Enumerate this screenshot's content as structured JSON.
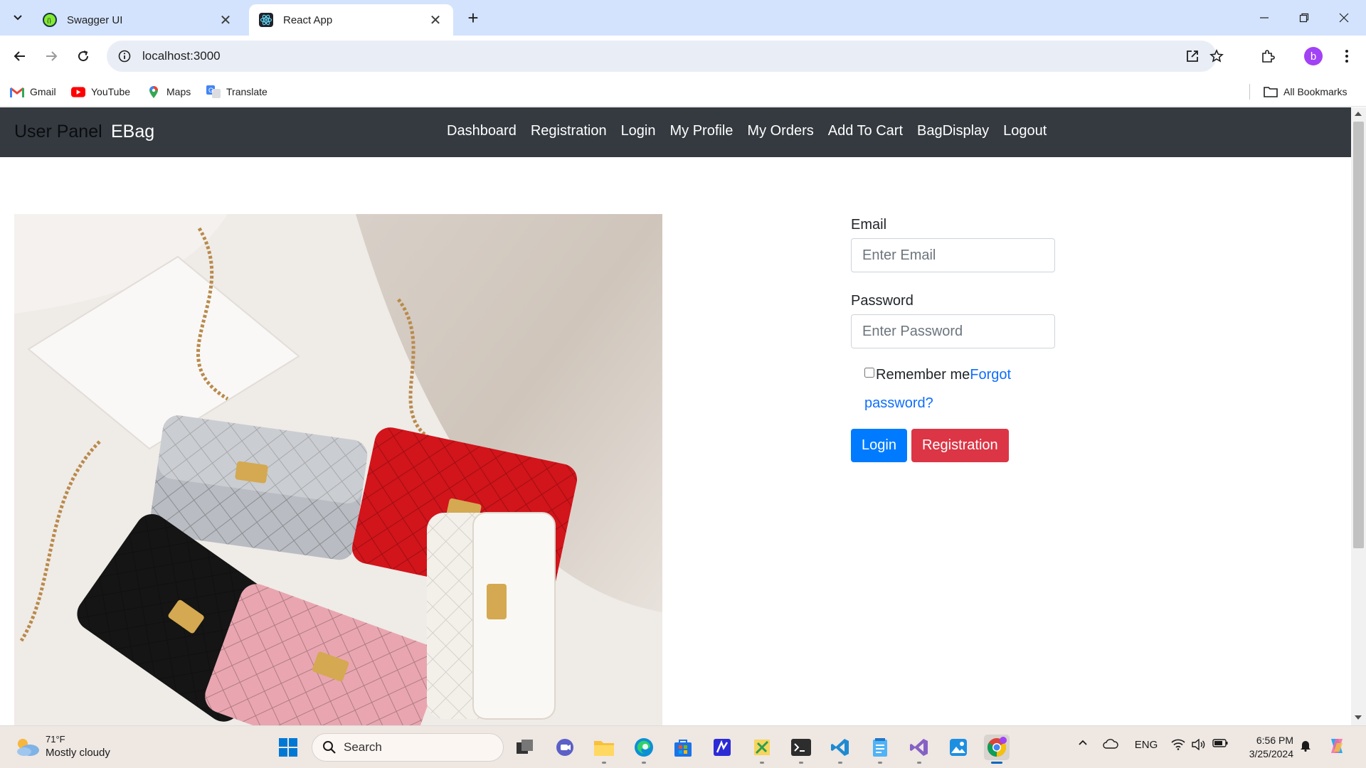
{
  "browser": {
    "tabs": [
      {
        "title": "Swagger UI",
        "active": false,
        "favicon": "swagger-icon"
      },
      {
        "title": "React App",
        "active": true,
        "favicon": "react-icon"
      }
    ],
    "url": "localhost:3000",
    "bookmarks": [
      {
        "label": "Gmail",
        "icon": "gmail-icon"
      },
      {
        "label": "YouTube",
        "icon": "youtube-icon"
      },
      {
        "label": "Maps",
        "icon": "maps-icon"
      },
      {
        "label": "Translate",
        "icon": "translate-icon"
      }
    ],
    "all_bookmarks": "All Bookmarks",
    "profile_initial": "b"
  },
  "navbar": {
    "brand_muted": "User Panel",
    "brand": "EBag",
    "links": [
      "Dashboard",
      "Registration",
      "Login",
      "My Profile",
      "My Orders",
      "Add To Cart",
      "BagDisplay",
      "Logout"
    ]
  },
  "form": {
    "email_label": "Email",
    "email_placeholder": "Enter Email",
    "password_label": "Password",
    "password_placeholder": "Enter Password",
    "remember_label": "Remember me",
    "forgot_link": "Forgot password?",
    "login_button": "Login",
    "registration_button": "Registration"
  },
  "taskbar": {
    "weather_temp": "71°F",
    "weather_desc": "Mostly cloudy",
    "search_label": "Search",
    "language": "ENG",
    "time": "6:56 PM",
    "date": "3/25/2024"
  },
  "colors": {
    "navbar_bg": "#343a40",
    "primary": "#007bff",
    "danger": "#dc3545",
    "link": "#0d6efd",
    "tabstrip": "#d3e3fd"
  }
}
